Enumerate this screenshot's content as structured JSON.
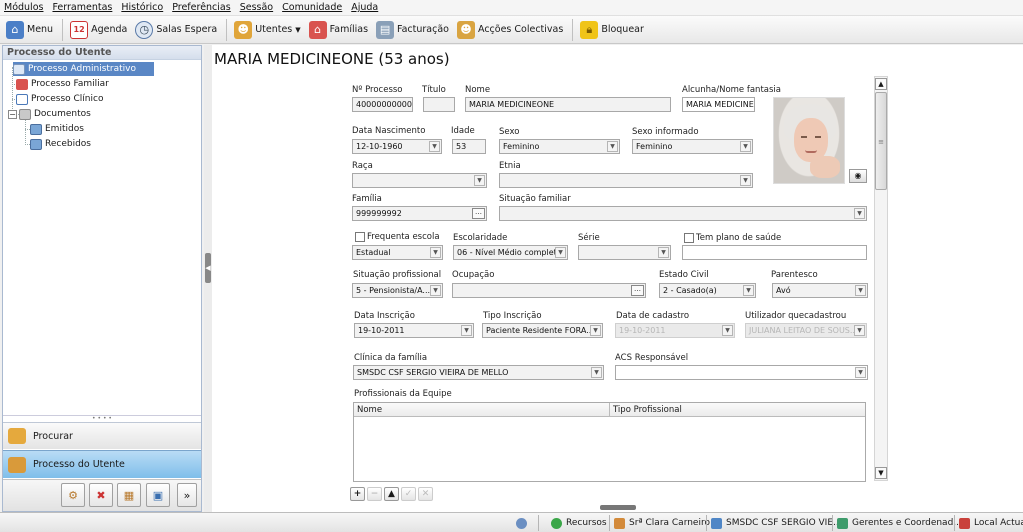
{
  "menubar": [
    "Módulos",
    "Ferramentas",
    "Histórico",
    "Preferências",
    "Sessão",
    "Comunidade",
    "Ajuda"
  ],
  "toolbar": {
    "menu": "Menu",
    "agenda": "Agenda",
    "agenda_day": "12",
    "salas": "Salas Espera",
    "utentes": "Utentes",
    "familias": "Famílias",
    "facturacao": "Facturação",
    "accoes": "Acções Colectivas",
    "bloquear": "Bloquear"
  },
  "left": {
    "header": "Processo do Utente",
    "tree": {
      "admin": "Processo Administrativo",
      "familiar": "Processo Familiar",
      "clinico": "Processo Clínico",
      "documentos": "Documentos",
      "emitidos": "Emitidos",
      "recebidos": "Recebidos"
    },
    "nav_procurar": "Procurar",
    "nav_processo": "Processo do Utente"
  },
  "patient": {
    "title": "MARIA MEDICINEONE (53 anos)",
    "labels": {
      "num_processo": "Nº Processo",
      "titulo": "Título",
      "nome": "Nome",
      "alcunha": "Alcunha/Nome fantasia",
      "data_nasc": "Data Nascimento",
      "idade": "Idade",
      "sexo": "Sexo",
      "sexo_inf": "Sexo informado",
      "raca": "Raça",
      "etnia": "Etnia",
      "familia": "Família",
      "situacao_familiar": "Situação familiar",
      "frequenta_escola": "Frequenta escola",
      "escolaridade": "Escolaridade",
      "serie": "Série",
      "plano_saude": "Tem plano de saúde",
      "situacao_prof": "Situação profissional",
      "ocupacao": "Ocupação",
      "estado_civil": "Estado Civil",
      "parentesco": "Parentesco",
      "data_inscricao": "Data Inscrição",
      "tipo_inscricao": "Tipo Inscrição",
      "data_cadastro": "Data de cadastro",
      "utilizador": "Utilizador quecadastrou",
      "clinica": "Clínica da família",
      "acs": "ACS Responsável",
      "profissionais": "Profissionais da Equipe"
    },
    "values": {
      "num_processo": "40000000000",
      "titulo": "",
      "nome": "MARIA MEDICINEONE",
      "alcunha": "MARIA MEDICINEO",
      "data_nasc": "12-10-1960",
      "idade": "53",
      "sexo": "Feminino",
      "sexo_inf": "Feminino",
      "raca": "",
      "etnia": "",
      "familia": "999999992",
      "situacao_familiar": "",
      "escola_tipo": "Estadual",
      "escolaridade": "06 - Nível Médio complet...",
      "serie": "",
      "plano_saude": "",
      "situacao_prof": "5 - Pensionista/A...",
      "ocupacao": "",
      "estado_civil": "2 - Casado(a)",
      "parentesco": "Avó",
      "data_inscricao": "19-10-2011",
      "tipo_inscricao": "Paciente Residente FORA...",
      "data_cadastro": "19-10-2011",
      "utilizador": "JULIANA LEITAO DE SOUS...",
      "clinica": "SMSDC CSF SERGIO VIEIRA DE MELLO",
      "acs": ""
    },
    "grid_headers": [
      "Nome",
      "Tipo Profissional"
    ]
  },
  "grid_buttons": [
    "+",
    "−",
    "▲",
    "✓",
    "✕"
  ],
  "statusbar": {
    "recursos": "Recursos",
    "user": "Srª Clara Carneiro",
    "unit": "SMSDC CSF SERGIO VIE...",
    "group": "Gerentes e Coordenad...",
    "local": "Local Actual"
  }
}
